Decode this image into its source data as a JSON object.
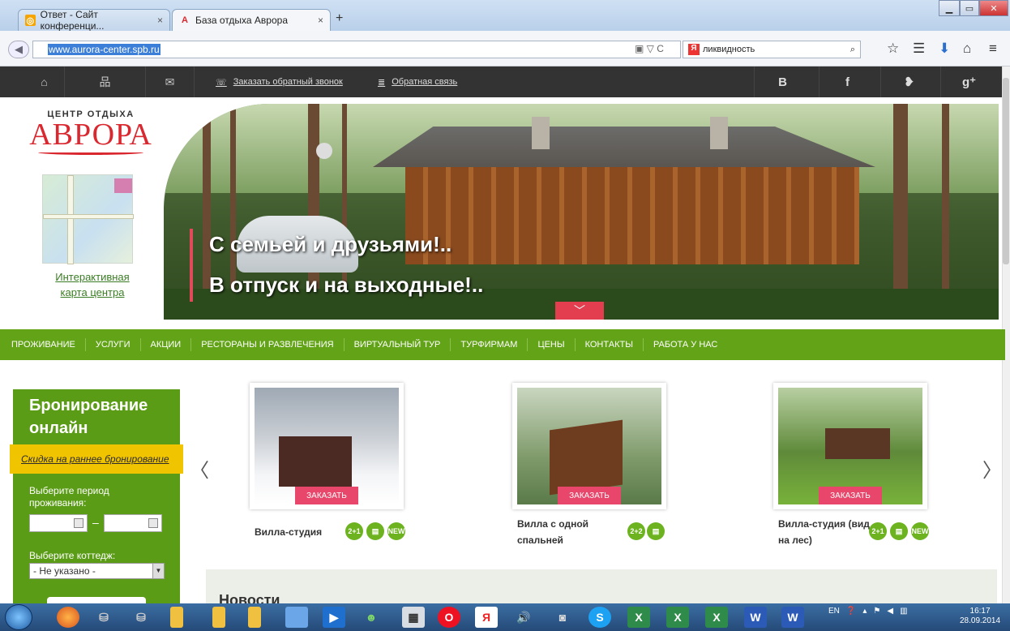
{
  "browser": {
    "tabs": [
      {
        "label": "Ответ - Сайт конференци...",
        "close": "×"
      },
      {
        "label": "База отдыха Аврора",
        "close": "×"
      }
    ],
    "new_tab": "+",
    "url": "www.aurora-center.spb.ru",
    "search_text": "ликвидность",
    "yandex_label": "Я"
  },
  "topbar": {
    "callback": "Заказать обратный звонок",
    "feedback": "Обратная связь",
    "socials": [
      "B",
      "f",
      "❥",
      "g⁺"
    ]
  },
  "logo": {
    "small": "ЦЕНТР ОТДЫХА",
    "big": "АВРОРА"
  },
  "map_link": [
    "Интерактивная",
    "карта центра"
  ],
  "hero": {
    "line1": "С семьей и друзьями!..",
    "line2": "В отпуск и на выходные!.."
  },
  "nav": [
    "ПРОЖИВАНИЕ",
    "УСЛУГИ",
    "АКЦИИ",
    "РЕСТОРАНЫ И РАЗВЛЕЧЕНИЯ",
    "ВИРТУАЛЬНЫЙ ТУР",
    "ТУРФИРМАМ",
    "ЦЕНЫ",
    "КОНТАКТЫ",
    "РАБОТА У НАС"
  ],
  "booking": {
    "title_1": "Бронирование",
    "title_2": "онлайн",
    "discount": "Скидка на раннее бронирование",
    "period_1": "Выберите период",
    "period_2": "проживания:",
    "dash": "–",
    "cottage_label": "Выберите коттедж:",
    "cottage_value": "- Не указано -"
  },
  "cards": [
    {
      "name_1": "Вилла-студия",
      "name_2": "",
      "order": "ЗАКАЗАТЬ",
      "badges": [
        "2+1",
        "▤",
        "NEW"
      ]
    },
    {
      "name_1": "Вилла с одной",
      "name_2": "спальней",
      "order": "ЗАКАЗАТЬ",
      "badges": [
        "2+2",
        "▤"
      ]
    },
    {
      "name_1": "Вилла-студия (вид",
      "name_2": "на лес)",
      "order": "ЗАКАЗАТЬ",
      "badges": [
        "2+1",
        "▤",
        "NEW"
      ]
    }
  ],
  "news_title": "Новости",
  "taskbar": {
    "lang": "EN",
    "time": "16:17",
    "date": "28.09.2014"
  },
  "colors": {
    "green": "#63a318",
    "red": "#d9282f",
    "accent_pink": "#e8466a",
    "badge": "#6cb31f"
  }
}
